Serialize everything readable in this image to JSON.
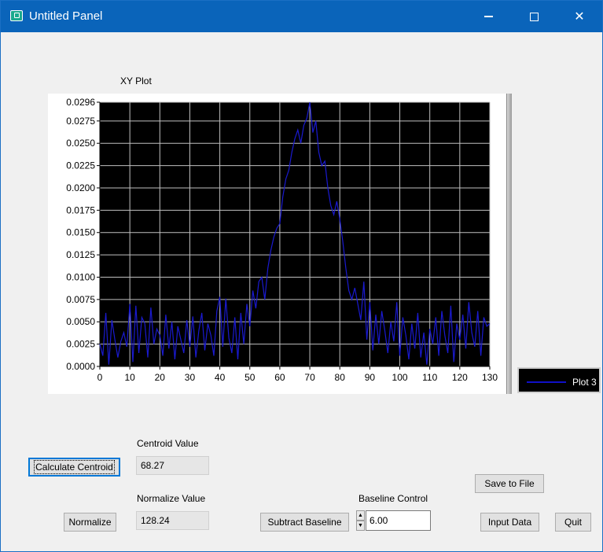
{
  "window": {
    "title": "Untitled Panel",
    "minimize_glyph": "",
    "close_glyph": "✕"
  },
  "plot": {
    "title": "XY Plot",
    "legend_label": "Plot 3",
    "background": "#000000",
    "line_color": "#1a1ad0",
    "grid_color": "#c0c0c0"
  },
  "chart_data": {
    "type": "line",
    "title": "XY Plot",
    "xlabel": "",
    "ylabel": "",
    "xlim": [
      0,
      130
    ],
    "ylim": [
      0,
      0.0296
    ],
    "grid": true,
    "legend_position": "right-bottom",
    "x_ticks": [
      "0",
      "10",
      "20",
      "30",
      "40",
      "50",
      "60",
      "70",
      "80",
      "90",
      "100",
      "110",
      "120",
      "130"
    ],
    "y_ticks": [
      "0.0000",
      "0.0025",
      "0.0050",
      "0.0075",
      "0.0100",
      "0.0125",
      "0.0150",
      "0.0175",
      "0.0200",
      "0.0225",
      "0.0250",
      "0.0275",
      "0.0296"
    ],
    "series": [
      {
        "name": "Plot 3",
        "x": [
          0,
          1,
          2,
          3,
          4,
          5,
          6,
          7,
          8,
          9,
          10,
          11,
          12,
          13,
          14,
          15,
          16,
          17,
          18,
          19,
          20,
          21,
          22,
          23,
          24,
          25,
          26,
          27,
          28,
          29,
          30,
          31,
          32,
          33,
          34,
          35,
          36,
          37,
          38,
          39,
          40,
          41,
          42,
          43,
          44,
          45,
          46,
          47,
          48,
          49,
          50,
          51,
          52,
          53,
          54,
          55,
          56,
          57,
          58,
          59,
          60,
          61,
          62,
          63,
          64,
          65,
          66,
          67,
          68,
          69,
          70,
          71,
          72,
          73,
          74,
          75,
          76,
          77,
          78,
          79,
          80,
          81,
          82,
          83,
          84,
          85,
          86,
          87,
          88,
          89,
          90,
          91,
          92,
          93,
          94,
          95,
          96,
          97,
          98,
          99,
          100,
          101,
          102,
          103,
          104,
          105,
          106,
          107,
          108,
          109,
          110,
          111,
          112,
          113,
          114,
          115,
          116,
          117,
          118,
          119,
          120,
          121,
          122,
          123,
          124,
          125,
          126,
          127,
          128,
          129,
          130
        ],
        "y": [
          0.0025,
          0.0012,
          0.006,
          0.0002,
          0.0052,
          0.003,
          0.001,
          0.0028,
          0.0038,
          0.0022,
          0.007,
          0.0005,
          0.0068,
          0.0015,
          0.0055,
          0.0048,
          0.001,
          0.0066,
          0.0025,
          0.0042,
          0.0035,
          0.0012,
          0.0058,
          0.002,
          0.005,
          0.0008,
          0.0045,
          0.003,
          0.0015,
          0.0052,
          0.0022,
          0.0056,
          0.001,
          0.004,
          0.006,
          0.0018,
          0.0048,
          0.0035,
          0.0012,
          0.0062,
          0.0078,
          0.0022,
          0.0076,
          0.0032,
          0.0015,
          0.0055,
          0.0008,
          0.006,
          0.0025,
          0.007,
          0.0045,
          0.0085,
          0.0065,
          0.0095,
          0.01,
          0.0075,
          0.011,
          0.013,
          0.0145,
          0.0155,
          0.016,
          0.019,
          0.021,
          0.022,
          0.024,
          0.0255,
          0.0265,
          0.025,
          0.027,
          0.0278,
          0.0296,
          0.0262,
          0.0275,
          0.024,
          0.0225,
          0.023,
          0.02,
          0.018,
          0.017,
          0.0185,
          0.0165,
          0.014,
          0.011,
          0.0085,
          0.0075,
          0.0088,
          0.007,
          0.0052,
          0.0095,
          0.003,
          0.0072,
          0.0018,
          0.0058,
          0.0025,
          0.0062,
          0.004,
          0.0015,
          0.005,
          0.0028,
          0.0072,
          0.0012,
          0.0055,
          0.0035,
          0.0008,
          0.0048,
          0.002,
          0.006,
          0.001,
          0.0038,
          0.0002,
          0.0042,
          0.0025,
          0.0055,
          0.0012,
          0.0062,
          0.0035,
          0.0015,
          0.0068,
          0.0005,
          0.0048,
          0.003,
          0.0058,
          0.002,
          0.0072,
          0.0038,
          0.0022,
          0.0062,
          0.0012,
          0.0055,
          0.0045,
          0.0048
        ]
      }
    ]
  },
  "controls": {
    "calc_centroid_label": "Calculate Centroid",
    "centroid_label": "Centroid Value",
    "centroid_value": "68.27",
    "normalize_label": "Normalize",
    "normalize_value_label": "Normalize Value",
    "normalize_value": "128.24",
    "subtract_baseline_label": "Subtract Baseline",
    "baseline_control_label": "Baseline Control",
    "baseline_value": "6.00",
    "save_to_file_label": "Save to File",
    "input_data_label": "Input Data",
    "quit_label": "Quit"
  }
}
